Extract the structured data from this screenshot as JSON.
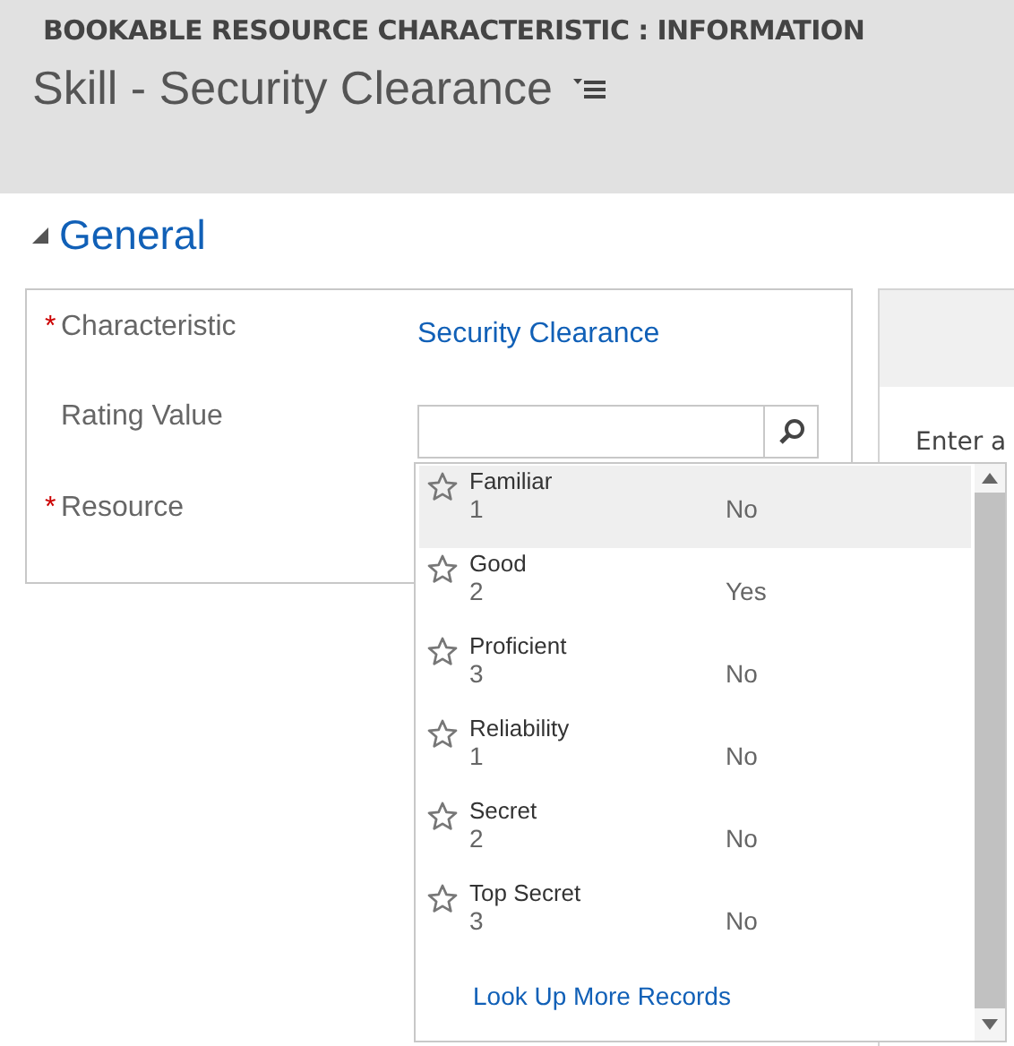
{
  "header": {
    "entity": "BOOKABLE RESOURCE CHARACTERISTIC : INFORMATION",
    "title": "Skill - Security Clearance"
  },
  "required_mark": "*",
  "section": {
    "title": "General",
    "expanded": true
  },
  "fields": [
    {
      "label": "Characteristic",
      "required": true,
      "value": "Security Clearance",
      "kind": "link"
    },
    {
      "label": "Rating Value",
      "required": false,
      "kind": "lookup"
    },
    {
      "label": "Resource",
      "required": true,
      "kind": "empty"
    }
  ],
  "side_panel": {
    "hint": "Enter a"
  },
  "dropdown": {
    "items": [
      {
        "name": "Familiar",
        "value": "1",
        "default": "No",
        "selected": true
      },
      {
        "name": "Good",
        "value": "2",
        "default": "Yes",
        "selected": false
      },
      {
        "name": "Proficient",
        "value": "3",
        "default": "No",
        "selected": false
      },
      {
        "name": "Reliability",
        "value": "1",
        "default": "No",
        "selected": false
      },
      {
        "name": "Secret",
        "value": "2",
        "default": "No",
        "selected": false
      },
      {
        "name": "Top Secret",
        "value": "3",
        "default": "No",
        "selected": false
      }
    ],
    "more_link": "Look Up More Records"
  }
}
